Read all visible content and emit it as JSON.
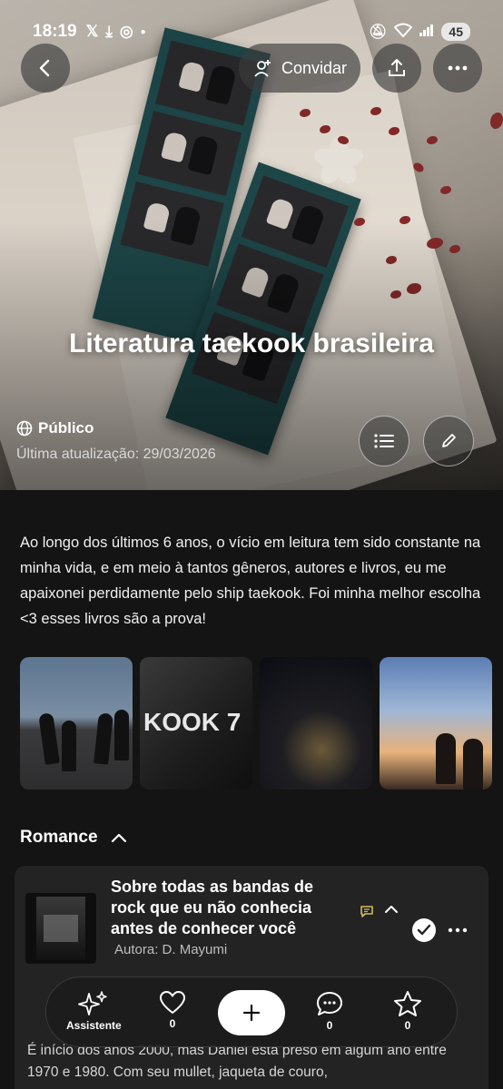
{
  "status": {
    "time": "18:19",
    "battery": "45"
  },
  "header": {
    "invite_label": "Convidar"
  },
  "hero": {
    "title": "Literatura taekook brasileira",
    "visibility": "Público",
    "updated": "Última atualização: 29/03/2026"
  },
  "description": "Ao longo dos últimos 6 anos, o vício em leitura tem sido constante na minha vida, e em meio à tantos gêneros, autores e livros, eu me apaixonei perdidamente pelo ship taekook. Foi minha melhor escolha <3 esses livros são a prova!",
  "gallery": {
    "image2_text": "KOOK 7"
  },
  "section": {
    "title": "Romance"
  },
  "book": {
    "title": "Sobre todas as bandas de rock que eu não conhecia antes de conhecer você",
    "author": "Autora: D. Mayumi",
    "excerpt": "É início dos anos 2000, mas Daniel está preso em algum ano entre 1970 e 1980. Com seu mullet, jaqueta de couro,"
  },
  "nav": {
    "assistant_label": "Assistente",
    "likes": "0",
    "comments": "0",
    "stars": "0"
  }
}
